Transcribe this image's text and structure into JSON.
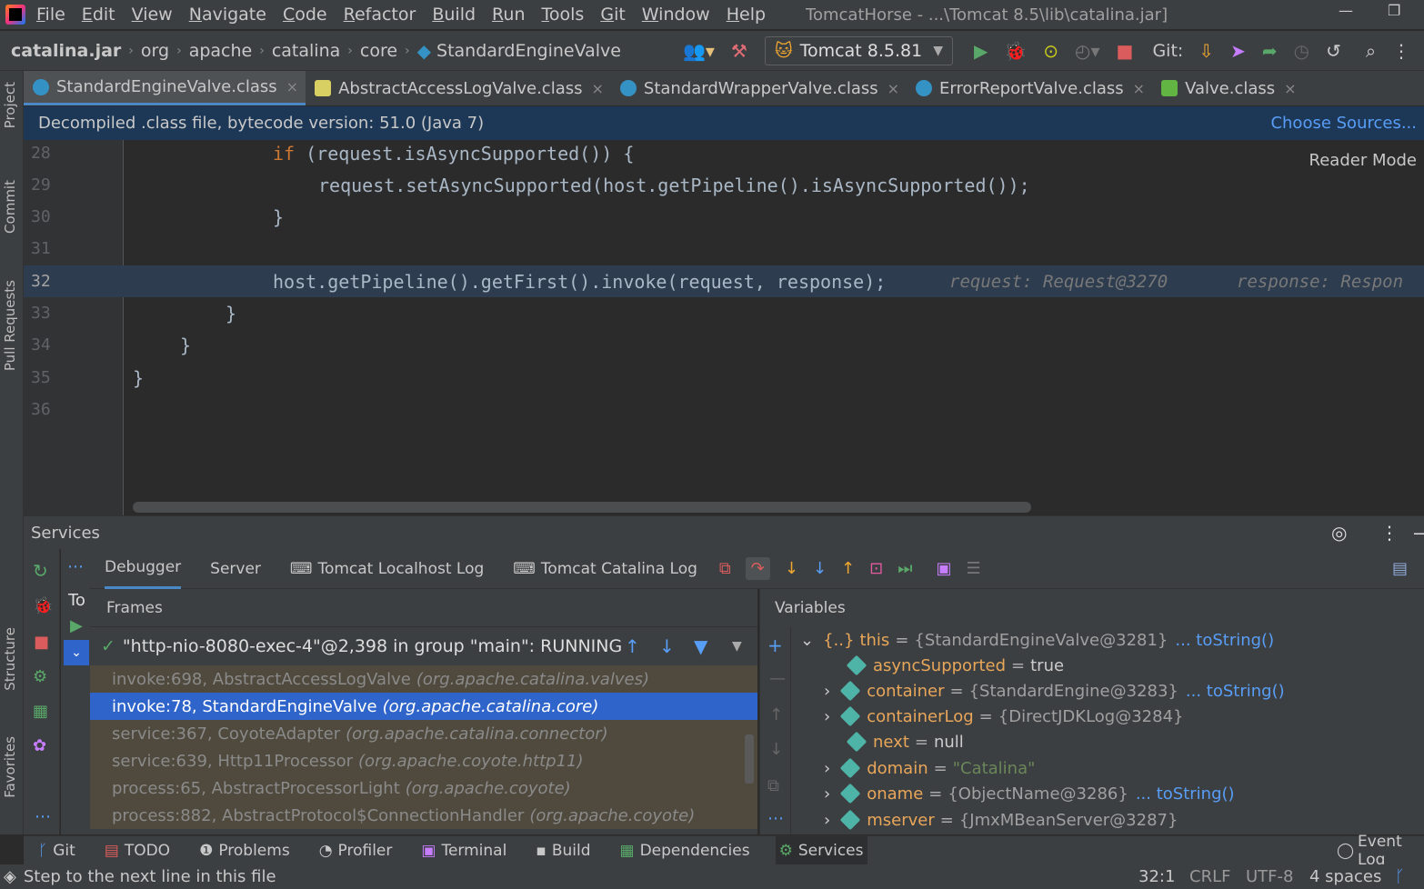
{
  "menu": {
    "items": [
      "File",
      "Edit",
      "View",
      "Navigate",
      "Code",
      "Refactor",
      "Build",
      "Run",
      "Tools",
      "Git",
      "Window",
      "Help"
    ],
    "window_title": "TomcatHorse - ...\\Tomcat 8.5\\lib\\catalina.jar]"
  },
  "nav": {
    "crumbs": [
      "catalina.jar",
      "org",
      "apache",
      "catalina",
      "core",
      "StandardEngineValve"
    ],
    "run_config": "Tomcat 8.5.81",
    "git_label": "Git:"
  },
  "tool_windows_left": [
    "Project",
    "Commit",
    "Pull Requests",
    "Structure",
    "Favorites"
  ],
  "tabs": [
    {
      "label": "StandardEngineValve.class",
      "color": "#3592c4"
    },
    {
      "label": "AbstractAccessLogValve.class",
      "color": "#d8d062"
    },
    {
      "label": "StandardWrapperValve.class",
      "color": "#3592c4"
    },
    {
      "label": "ErrorReportValve.class",
      "color": "#3592c4"
    },
    {
      "label": "Valve.class",
      "color": "#62b543"
    }
  ],
  "banner": {
    "text": "Decompiled .class file, bytecode version: 51.0 (Java 7)",
    "link": "Choose Sources..."
  },
  "editor": {
    "reader_mode": "Reader Mode",
    "lines": [
      {
        "n": "28",
        "kw": "if",
        "code": " (request.isAsyncSupported()) {"
      },
      {
        "n": "29",
        "code": "request.setAsyncSupported(host.getPipeline().isAsyncSupported());"
      },
      {
        "n": "30",
        "code": "}"
      },
      {
        "n": "31",
        "code": ""
      },
      {
        "n": "32",
        "code": "host.getPipeline().getFirst().invoke(request, response);",
        "hint1": "request: Request@3270",
        "hint2": "response: Respon"
      },
      {
        "n": "33",
        "code": "}"
      },
      {
        "n": "34",
        "code": "}"
      },
      {
        "n": "35",
        "code": "}"
      },
      {
        "n": "36",
        "code": ""
      }
    ]
  },
  "services": {
    "title": "Services",
    "tabs": [
      "Debugger",
      "Server",
      "Tomcat Localhost Log",
      "Tomcat Catalina Log"
    ],
    "tree_label": "To",
    "frames_header": "Frames",
    "thread": "\"http-nio-8080-exec-4\"@2,398 in group \"main\": RUNNING",
    "frames": [
      {
        "method": "invoke:698, AbstractAccessLogValve",
        "pkg": "(org.apache.catalina.valves)"
      },
      {
        "method": "invoke:78, StandardEngineValve",
        "pkg": "(org.apache.catalina.core)"
      },
      {
        "method": "service:367, CoyoteAdapter",
        "pkg": "(org.apache.catalina.connector)"
      },
      {
        "method": "service:639, Http11Processor",
        "pkg": "(org.apache.coyote.http11)"
      },
      {
        "method": "process:65, AbstractProcessorLight",
        "pkg": "(org.apache.coyote)"
      },
      {
        "method": "process:882, AbstractProtocol$ConnectionHandler",
        "pkg": "(org.apache.coyote)"
      }
    ],
    "variables_header": "Variables",
    "variables": [
      {
        "name": "this",
        "val": "{StandardEngineValve@3281}",
        "link": "... toString()"
      },
      {
        "name": "asyncSupported",
        "val": "true"
      },
      {
        "name": "container",
        "val": "{StandardEngine@3283}",
        "link": "... toString()"
      },
      {
        "name": "containerLog",
        "val": "{DirectJDKLog@3284}"
      },
      {
        "name": "next",
        "val": "null"
      },
      {
        "name": "domain",
        "val": "\"Catalina\""
      },
      {
        "name": "oname",
        "val": "{ObjectName@3286}",
        "link": "... toString()"
      },
      {
        "name": "mserver",
        "val": "{JmxMBeanServer@3287}"
      }
    ]
  },
  "bottom_tools": [
    "Git",
    "TODO",
    "Problems",
    "Profiler",
    "Terminal",
    "Build",
    "Dependencies",
    "Services",
    "Event Log"
  ],
  "status": {
    "message": "Step to the next line in this file",
    "position": "32:1",
    "line_sep": "CRLF",
    "encoding": "UTF-8",
    "indent": "4 spaces"
  }
}
